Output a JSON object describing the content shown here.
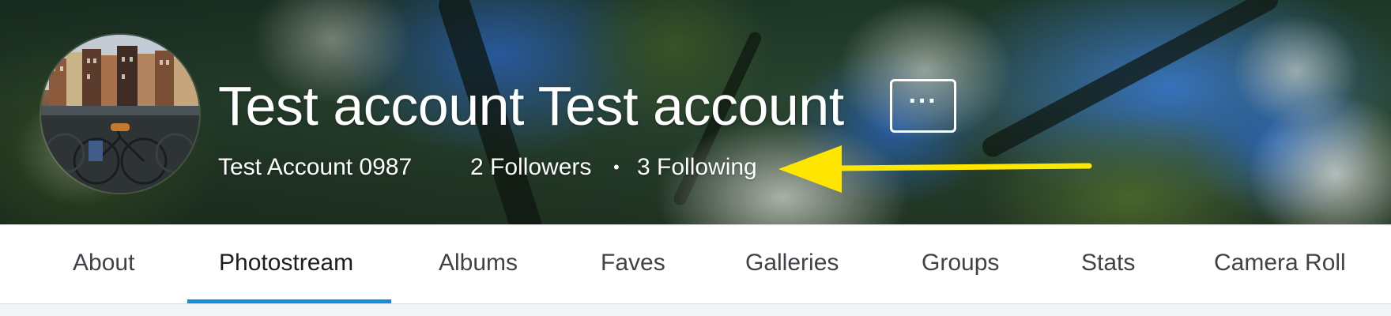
{
  "profile": {
    "display_name": "Test account Test account",
    "username": "Test Account 0987",
    "followers": "2 Followers",
    "separator": "•",
    "following": "3 Following",
    "more_label": "···"
  },
  "tabs": [
    {
      "label": "About",
      "active": false
    },
    {
      "label": "Photostream",
      "active": true
    },
    {
      "label": "Albums",
      "active": false
    },
    {
      "label": "Faves",
      "active": false
    },
    {
      "label": "Galleries",
      "active": false
    },
    {
      "label": "Groups",
      "active": false
    },
    {
      "label": "Stats",
      "active": false
    },
    {
      "label": "Camera Roll",
      "active": false
    }
  ],
  "colors": {
    "tab_underline": "#128fdc",
    "annotation_arrow": "#ffe600",
    "title_text": "#ffffff",
    "tab_text": "#3f4246"
  },
  "icons": {
    "more_button": "ellipsis-icon",
    "annotation": "arrow-left-icon"
  }
}
